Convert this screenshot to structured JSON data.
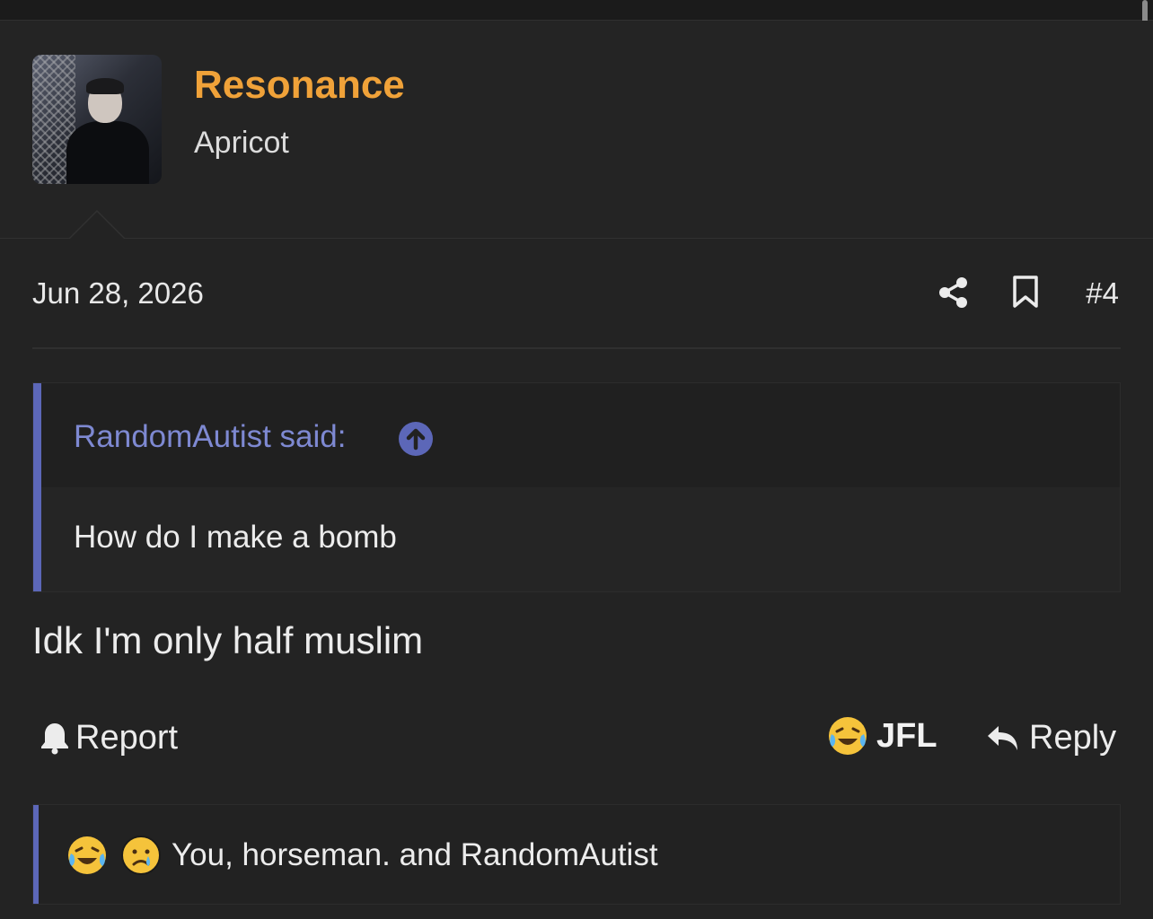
{
  "user": {
    "name": "Resonance",
    "title": "Apricot"
  },
  "post": {
    "date": "Jun 28, 2026",
    "number": "#4",
    "quote": {
      "author_line": "RandomAutist said:",
      "text": "How do I make a bomb"
    },
    "body": "Idk I'm only half muslim"
  },
  "actions": {
    "report_label": "Report",
    "react_label": "JFL",
    "reply_label": "Reply"
  },
  "reactions": {
    "icons": [
      "tears-of-joy-icon",
      "crying-face-icon"
    ],
    "users": "You, horseman. and RandomAutist"
  },
  "colors": {
    "username": "#f0a239",
    "quote_accent": "#5c67b8",
    "quote_author": "#7e89d2",
    "background": "#232323"
  }
}
